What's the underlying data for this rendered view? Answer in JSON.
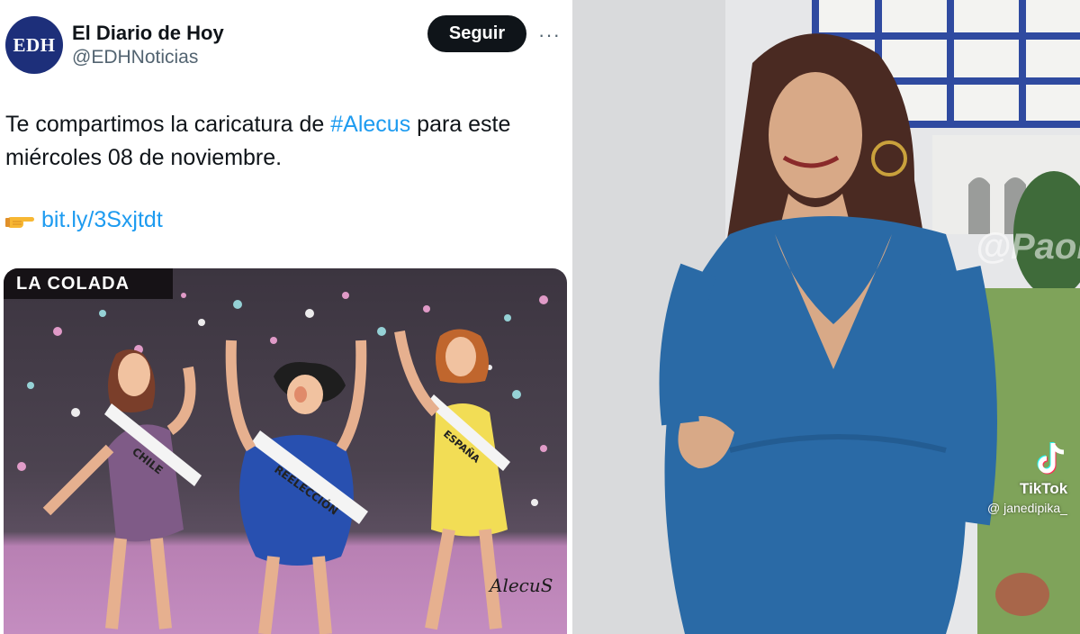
{
  "tweet": {
    "avatar_text": "EDH",
    "display_name": "El Diario de Hoy",
    "handle": "@EDHNoticias",
    "follow_label": "Seguir",
    "more_label": "···",
    "text_before": "Te compartimos la caricatura de ",
    "hashtag": "#Alecus",
    "text_after": " para este miércoles 08 de noviembre.",
    "link": "bit.ly/3Sxjtdt",
    "link_icon": "pointing-hand-icon"
  },
  "cartoon": {
    "title": "LA COLADA",
    "sash_left": "CHILE",
    "sash_center": "REELECCIÓN",
    "sash_right": "ESPAÑA",
    "signature": "AlecuS"
  },
  "photo": {
    "watermark": "@PaoMarrohs",
    "tiktok_label": "TikTok",
    "tiktok_user": "@ janedipika_"
  },
  "colors": {
    "brand_navy": "#1d2f7a",
    "link_blue": "#1d9bf0",
    "dress_blue": "#2a6aa6"
  }
}
